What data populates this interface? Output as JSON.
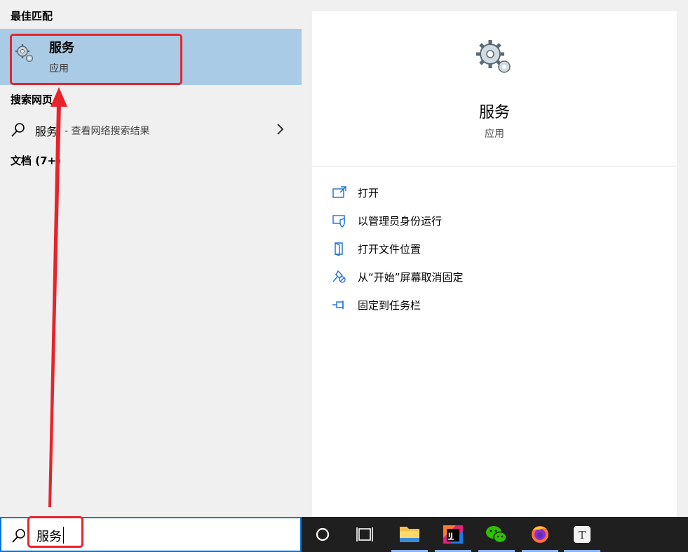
{
  "left": {
    "best_match_title": "最佳匹配",
    "best_match": {
      "name": "服务",
      "type": "应用",
      "icon": "services-gear-icon"
    },
    "web_section_title": "搜索网页",
    "web_result": {
      "term": "服务",
      "hint": "- 查看网络搜索结果"
    },
    "documents_title": "文档 (7+)"
  },
  "detail": {
    "name": "服务",
    "type": "应用",
    "actions": [
      {
        "label": "打开",
        "icon": "open-icon"
      },
      {
        "label": "以管理员身份运行",
        "icon": "run-as-admin-icon"
      },
      {
        "label": "打开文件位置",
        "icon": "file-location-icon"
      },
      {
        "label": "从“开始”屏幕取消固定",
        "icon": "unpin-icon"
      },
      {
        "label": "固定到任务栏",
        "icon": "pin-taskbar-icon"
      }
    ]
  },
  "search": {
    "value": "服务"
  },
  "taskbar": {
    "items": [
      "cortana-icon",
      "task-view-icon",
      "file-explorer-icon",
      "intellij-icon",
      "wechat-icon",
      "firefox-icon",
      "typora-icon"
    ]
  },
  "colors": {
    "highlight": "#aacbe6",
    "annotation": "#e8232b",
    "accent": "#0a74da"
  }
}
